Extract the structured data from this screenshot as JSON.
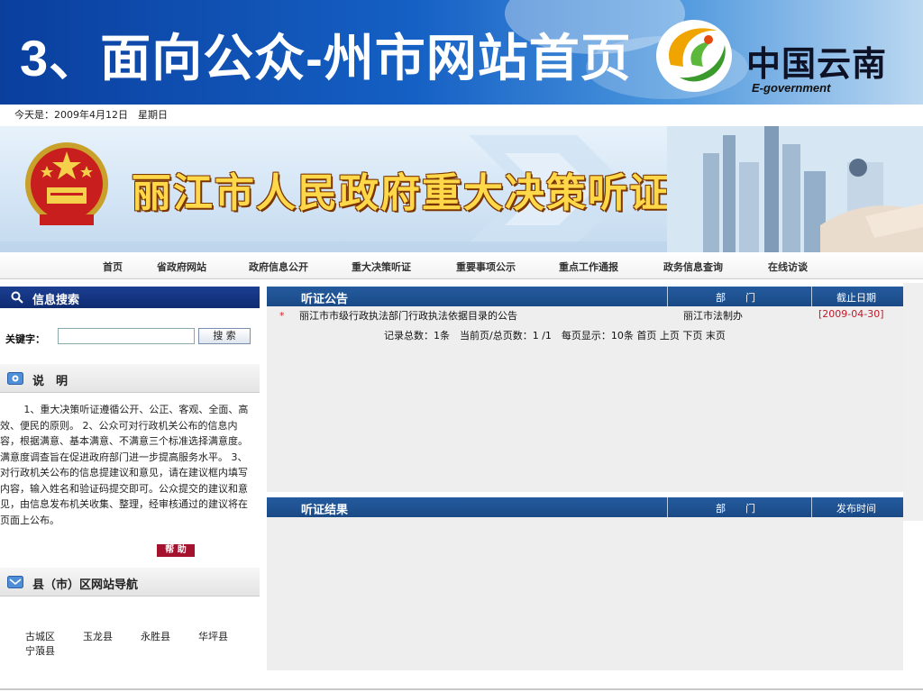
{
  "slide": {
    "title": "3、面向公众-州市网站首页",
    "logo_name": "中国云南",
    "logo_sub": "E-government"
  },
  "site": {
    "date_text": "今天是：2009年4月12日　星期日",
    "banner_title": "丽江市人民政府重大决策听证"
  },
  "nav": {
    "items": [
      "首页",
      "省政府网站",
      "政府信息公开",
      "重大决策听证",
      "重要事项公示",
      "重点工作通报",
      "政务信息查询",
      "在线访谈"
    ]
  },
  "search_panel": {
    "title": "信息搜索",
    "label": "关键字：",
    "input_value": "",
    "button": "搜 索"
  },
  "info_panel": {
    "title": "说　明",
    "text": "1、重大决策听证遵循公开、公正、客观、全面、高效、便民的原则。 2、公众可对行政机关公布的信息内容，根据满意、基本满意、不满意三个标准选择满意度。满意度调查旨在促进政府部门进一步提高服务水平。 3、对行政机关公布的信息提建议和意见，请在建议框内填写内容，输入姓名和验证码提交即可。公众提交的建议和意见，由信息发布机关收集、整理，经审核通过的建议将在页面上公布。",
    "help_button": "帮 助"
  },
  "county_panel": {
    "title": "县（市）区网站导航",
    "links": [
      "古城区",
      "玉龙县",
      "永胜县",
      "华坪县",
      "宁蒗县"
    ]
  },
  "notice_panel": {
    "title": "听证公告",
    "col_dept": "部　　门",
    "col_date": "截止日期",
    "rows": [
      {
        "marker": "*",
        "title": "丽江市市级行政执法部门行政执法依据目录的公告",
        "dept": "丽江市法制办",
        "date": "[2009-04-30]"
      }
    ],
    "pager": {
      "summary": "记录总数：1条　当前页/总页数：1 /1　每页显示：10条",
      "first": "首页",
      "prev": "上页",
      "next": "下页",
      "last": "末页"
    }
  },
  "result_panel": {
    "title": "听证结果",
    "col_dept": "部　　门",
    "col_date": "发布时间"
  }
}
